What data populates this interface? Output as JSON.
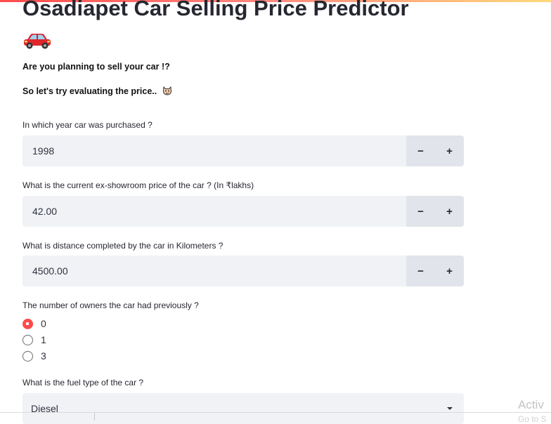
{
  "header": {
    "title": "Osadiapet Car Selling Price Predictor",
    "title_icon": "car-emoji"
  },
  "intro": {
    "question": "Are you planning to sell your car !?",
    "prompt": "So let's try evaluating the price..",
    "prompt_icon": "face-emoji"
  },
  "fields": {
    "year": {
      "label": "In which year car was purchased ?",
      "value": "1998"
    },
    "price": {
      "label": "What is the current ex-showroom price of the car ? (In ₹lakhs)",
      "value": "42.00"
    },
    "distance": {
      "label": "What is distance completed by the car in Kilometers ?",
      "value": "4500.00"
    },
    "stepper": {
      "minus": "−",
      "plus": "+"
    },
    "owners": {
      "label": "The number of owners the car had previously ?",
      "options": [
        "0",
        "1",
        "3"
      ],
      "selected": "0"
    },
    "fuel": {
      "label": "What is the fuel type of the car ?",
      "value": "Diesel"
    }
  },
  "watermark": {
    "line1": "Activ",
    "line2": "Go to S"
  },
  "colors": {
    "accent": "#ff4b4b",
    "input_bg": "#f0f2f6",
    "step_bg": "#e1e4ea",
    "text": "#262730"
  }
}
